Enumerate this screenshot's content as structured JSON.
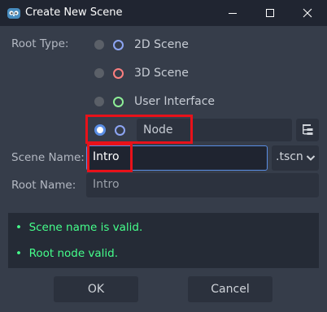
{
  "window": {
    "title": "Create New Scene",
    "controls": [
      "minimize",
      "maximize",
      "close"
    ]
  },
  "form": {
    "root_type_label": "Root Type:",
    "root_types": [
      {
        "label": "2D Scene",
        "icon": "node2d-icon",
        "icon_color": "#8da5f3",
        "selected": false
      },
      {
        "label": "3D Scene",
        "icon": "node3d-icon",
        "icon_color": "#fc7f7f",
        "selected": false
      },
      {
        "label": "User Interface",
        "icon": "control-icon",
        "icon_color": "#8eef97",
        "selected": false
      },
      {
        "label": "Node",
        "icon": "node-icon",
        "icon_color": "#8da5f3",
        "selected": true
      }
    ],
    "scene_name_label": "Scene Name:",
    "scene_name_value": "Intro",
    "extension_value": ".tscn",
    "root_name_label": "Root Name:",
    "root_name_placeholder": "Intro"
  },
  "messages": [
    {
      "bullet": "•",
      "text": "Scene name is valid."
    },
    {
      "bullet": "•",
      "text": "Root node valid."
    }
  ],
  "buttons": {
    "ok_label": "OK",
    "cancel_label": "Cancel"
  },
  "colors": {
    "accent": "#5a8ee5",
    "valid_text": "#45ff8b",
    "highlight": "#e8121a",
    "background": "#363d4a"
  }
}
